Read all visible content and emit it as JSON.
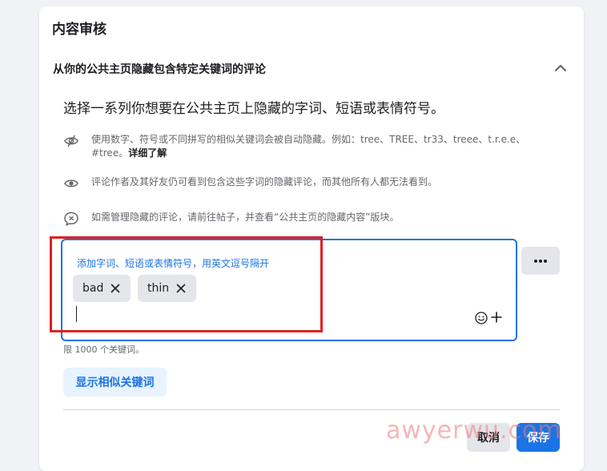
{
  "card": {
    "title": "内容审核",
    "section_title": "从你的公共主页隐藏包含特定关键词的评论",
    "description": "选择一系列你想要在公共主页上隐藏的字词、短语或表情符号。"
  },
  "info": [
    {
      "icon": "eye-slash-icon",
      "text": "使用数字、符号或不同拼写的相似关键词会被自动隐藏。例如：tree、TREE、tr33、treee、t.r.e.e、#tree。",
      "link": "详细了解"
    },
    {
      "icon": "eye-icon",
      "text": "评论作者及其好友仍可看到包含这些字词的隐藏评论，而其他所有人都无法看到。"
    },
    {
      "icon": "comment-x-icon",
      "text": "如需管理隐藏的评论，请前往帖子，并查看“公共主页的隐藏内容”版块。"
    }
  ],
  "keywords_input": {
    "placeholder": "添加字词、短语或表情符号，用英文逗号隔开",
    "chips": [
      "bad",
      "thin"
    ],
    "value": ""
  },
  "limit_text": "限 1000 个关键词。",
  "buttons": {
    "show_similar": "显示相似关键词",
    "cancel": "取消",
    "save": "保存"
  },
  "watermark": "awyerwu.com",
  "colors": {
    "accent": "#1b74e4",
    "highlight": "#e02020",
    "chip_bg": "#e4e6eb"
  }
}
